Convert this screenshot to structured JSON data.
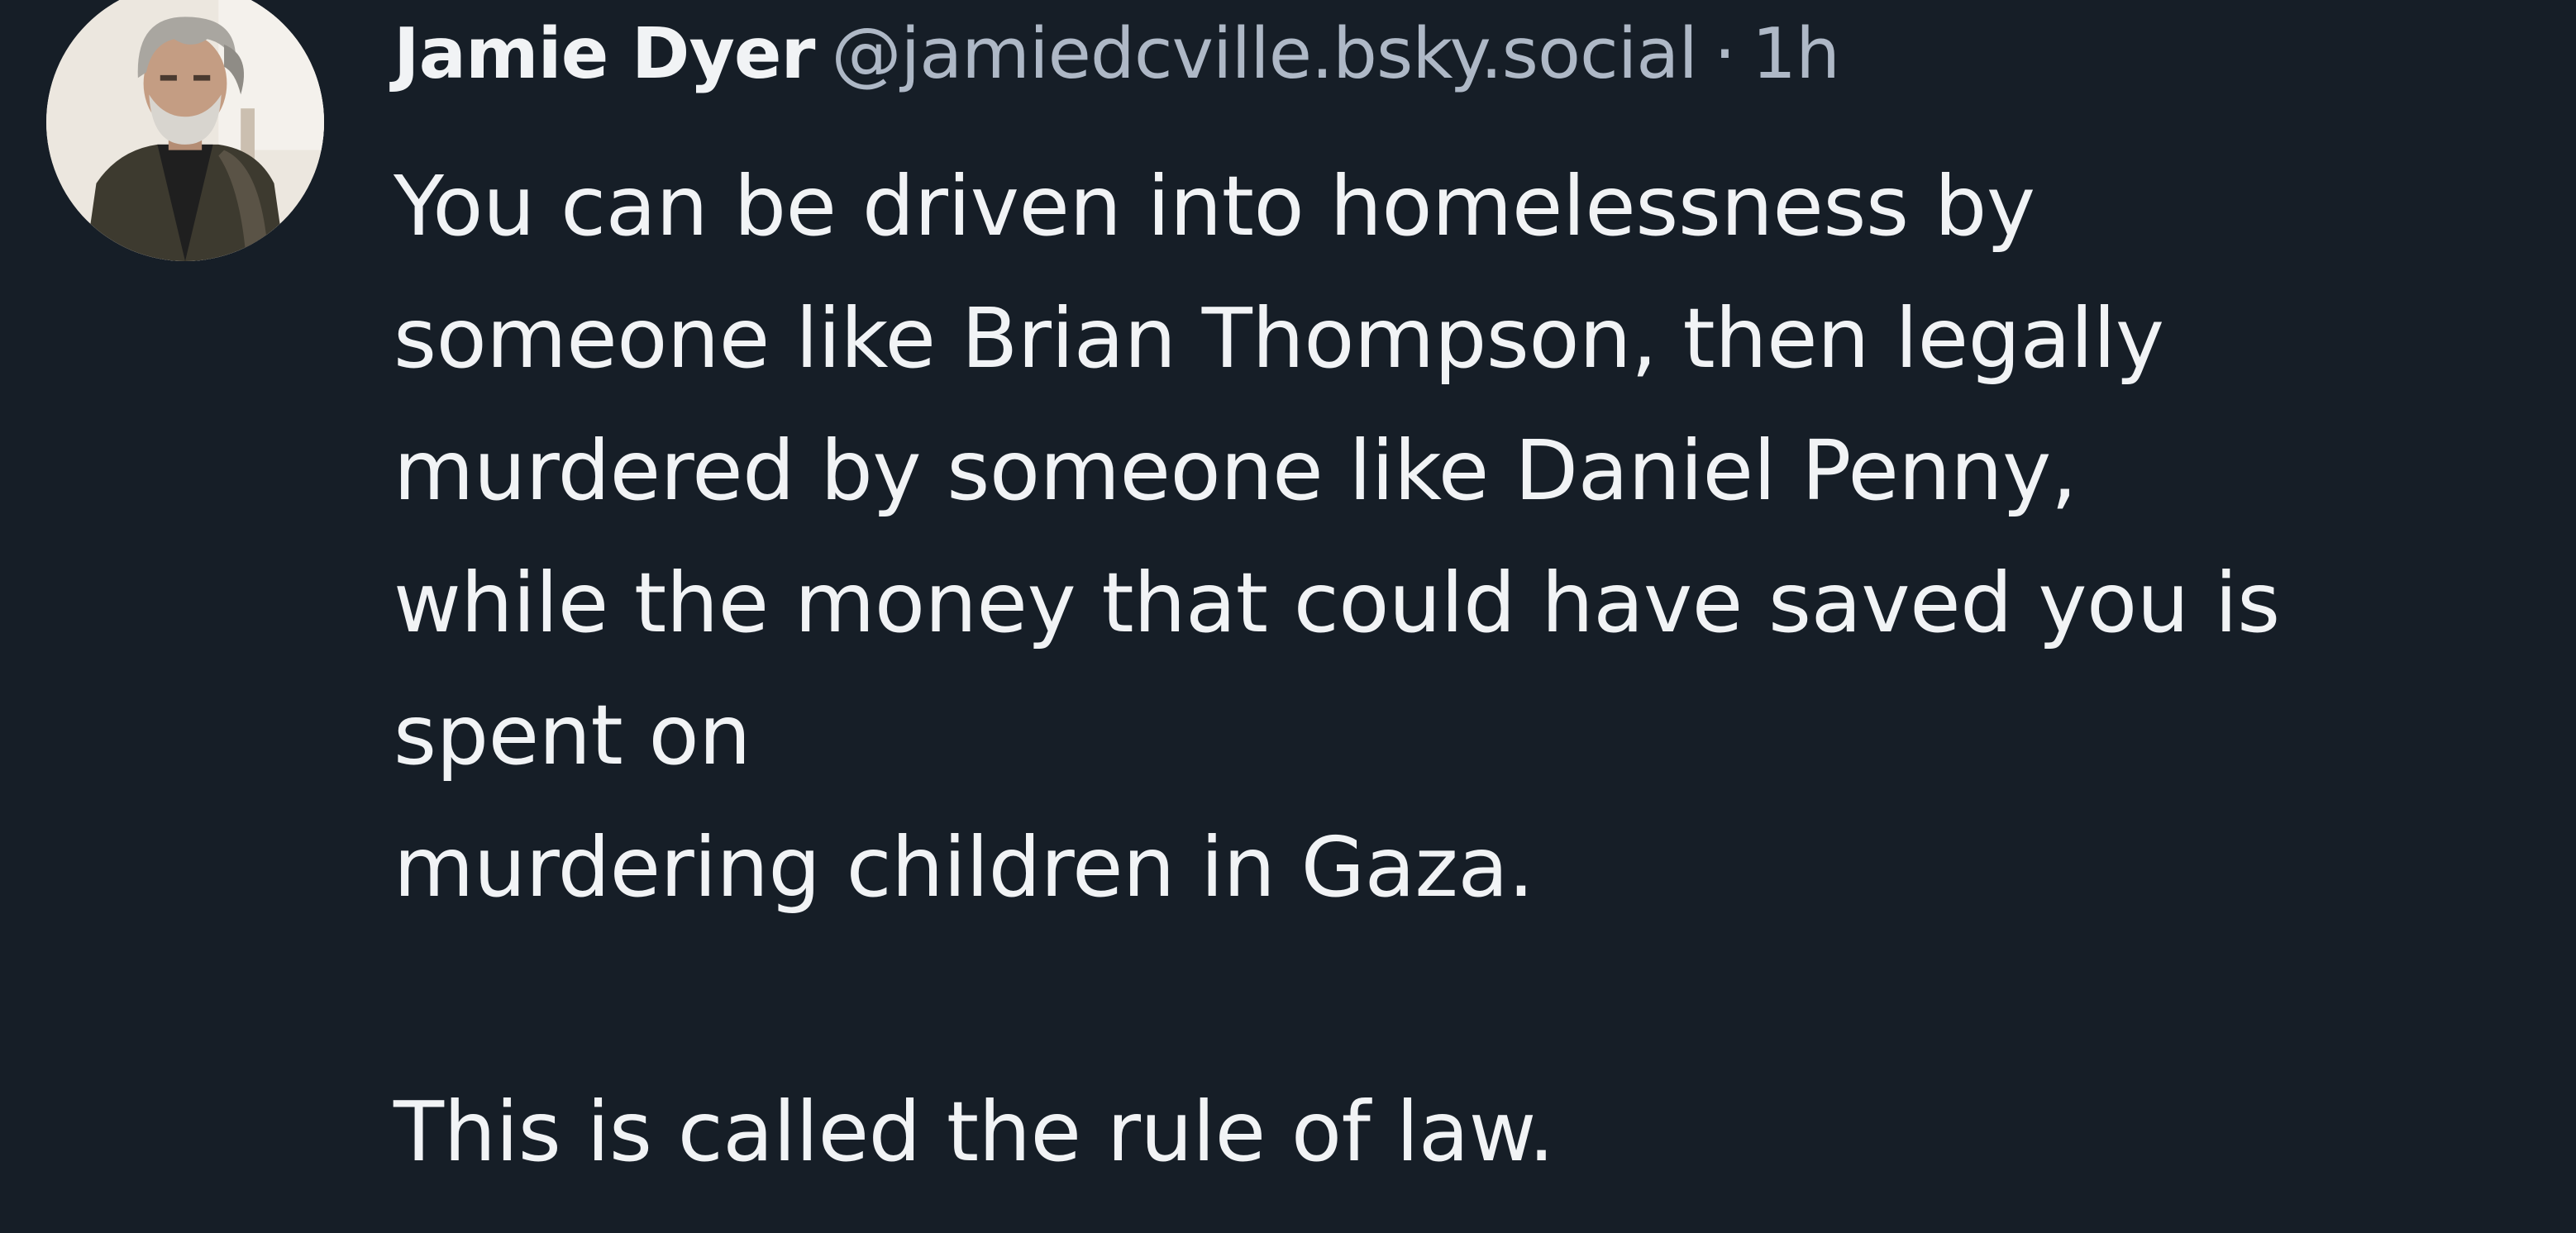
{
  "post": {
    "author": {
      "display_name": "Jamie Dyer",
      "handle": "@jamiedcville.bsky.social",
      "avatar": "profile-photo-gray-haired-man"
    },
    "separator": "·",
    "timestamp": "1h",
    "text_lines": [
      "You can be driven into homelessness by",
      "someone like Brian Thompson, then legally",
      "murdered by someone like Daniel Penny,",
      "while the money that could have saved you is",
      "spent on",
      "murdering children in Gaza.",
      "",
      "This is called the rule of law."
    ]
  },
  "colors": {
    "background": "#161e27",
    "text_primary": "#f1f3f5",
    "text_secondary": "#aeb8c6"
  }
}
